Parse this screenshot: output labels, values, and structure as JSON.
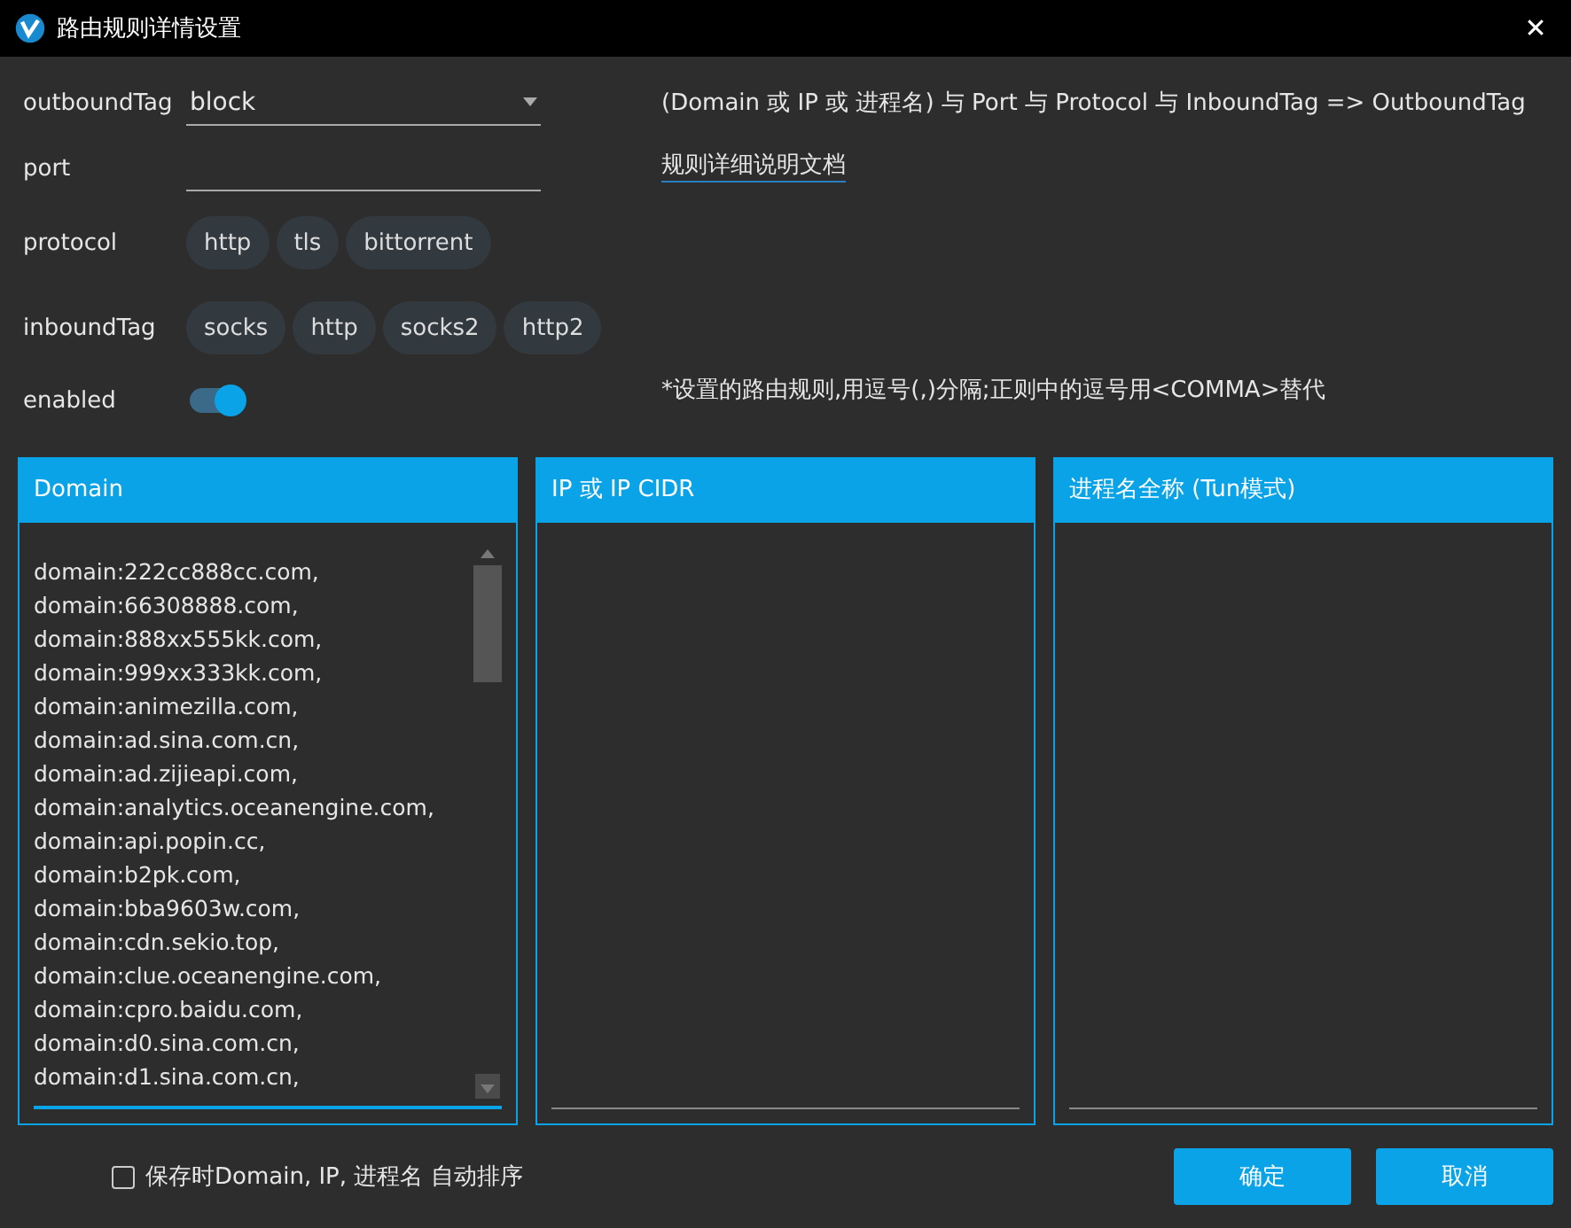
{
  "window": {
    "title": "路由规则详情设置",
    "close": "✕"
  },
  "form": {
    "outbound": {
      "label": "outboundTag",
      "value": "block"
    },
    "port": {
      "label": "port"
    },
    "protocol": {
      "label": "protocol",
      "chips": [
        {
          "label": "http",
          "selected": false
        },
        {
          "label": "tls",
          "selected": false
        },
        {
          "label": "bittorrent",
          "selected": false
        }
      ]
    },
    "inbound": {
      "label": "inboundTag",
      "chips": [
        {
          "label": "socks",
          "selected": false
        },
        {
          "label": "http",
          "selected": false
        },
        {
          "label": "socks2",
          "selected": false
        },
        {
          "label": "http2",
          "selected": false
        }
      ]
    },
    "enabled": {
      "label": "enabled",
      "on": true
    }
  },
  "hints": {
    "formula": "(Domain 或 IP 或 进程名) 与 Port 与 Protocol 与 InboundTag => OutboundTag",
    "doc_link": "规则详细说明文档",
    "note": "*设置的路由规则,用逗号(,)分隔;正则中的逗号用<COMMA>替代"
  },
  "panels": [
    {
      "title": "Domain",
      "lines": [
        "domain:222cc888cc.com,",
        "domain:66308888.com,",
        "domain:888xx555kk.com,",
        "domain:999xx333kk.com,",
        "domain:animezilla.com,",
        "domain:ad.sina.com.cn,",
        "domain:ad.zijieapi.com,",
        "domain:analytics.oceanengine.com,",
        "domain:api.popin.cc,",
        "domain:b2pk.com,",
        "domain:bba9603w.com,",
        "domain:cdn.sekio.top,",
        "domain:clue.oceanengine.com,",
        "domain:cpro.baidu.com,",
        "domain:d0.sina.com.cn,",
        "domain:d1.sina.com.cn,"
      ]
    },
    {
      "title": "IP 或 IP CIDR"
    },
    {
      "title": "进程名全称 (Tun模式)"
    }
  ],
  "footer": {
    "auto_sort": {
      "label": "保存时Domain, IP, 进程名 自动排序",
      "checked": false
    },
    "buttons": [
      "确定",
      "取消"
    ]
  }
}
